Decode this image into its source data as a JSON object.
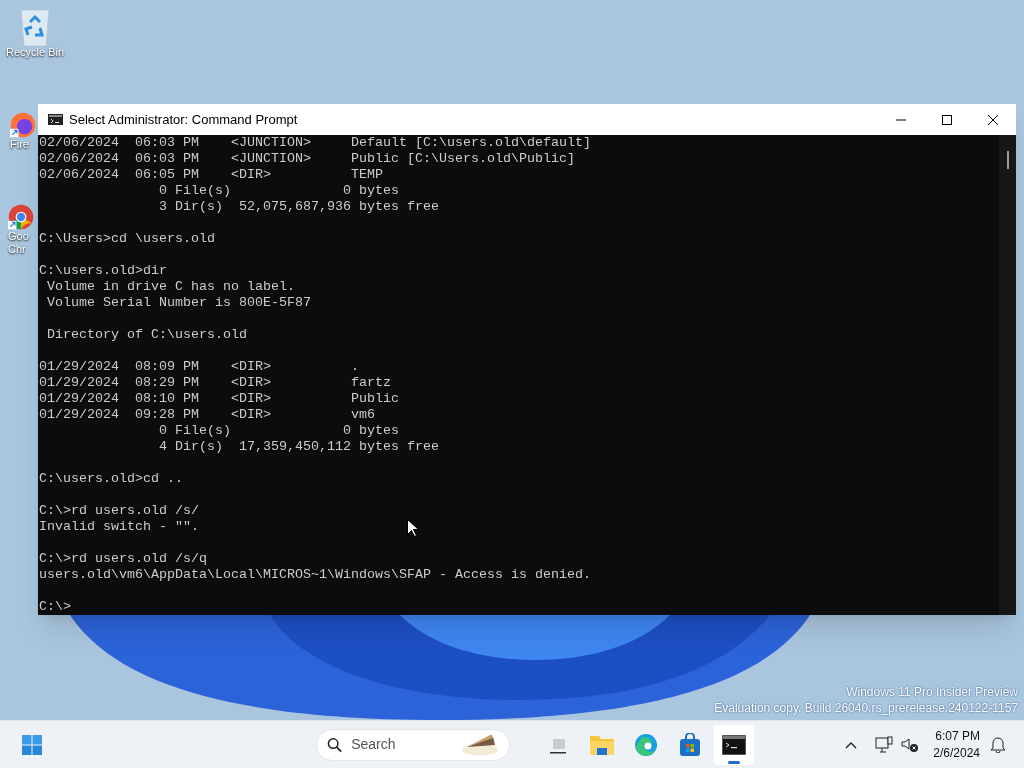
{
  "desktop_icons": [
    {
      "kind": "recycle",
      "label": [
        "Recycle Bin"
      ]
    },
    {
      "kind": "firefox",
      "label": [
        "Fire"
      ]
    },
    {
      "kind": "chrome",
      "label": [
        "Goo",
        "Chr"
      ]
    }
  ],
  "window": {
    "title": "Select Administrator: Command Prompt",
    "console_blocks": [
      [
        "02/06/2024  06:03 PM    <JUNCTION>     Default [C:\\users.old\\default]",
        "02/06/2024  06:03 PM    <JUNCTION>     Public [C:\\Users.old\\Public]",
        "02/06/2024  06:05 PM    <DIR>          TEMP",
        "               0 File(s)              0 bytes",
        "               3 Dir(s)  52,075,687,936 bytes free"
      ],
      [
        "C:\\Users>cd \\users.old"
      ],
      [
        "C:\\users.old>dir",
        " Volume in drive C has no label.",
        " Volume Serial Number is 800E-5F87"
      ],
      [
        " Directory of C:\\users.old"
      ],
      [
        "01/29/2024  08:09 PM    <DIR>          .",
        "01/29/2024  08:29 PM    <DIR>          fartz",
        "01/29/2024  08:10 PM    <DIR>          Public",
        "01/29/2024  09:28 PM    <DIR>          vm6",
        "               0 File(s)              0 bytes",
        "               4 Dir(s)  17,359,450,112 bytes free"
      ],
      [
        "C:\\users.old>cd .."
      ],
      [
        "C:\\>rd users.old /s/",
        "Invalid switch - \"\"."
      ],
      [
        "C:\\>rd users.old /s/q",
        "users.old\\vm6\\AppData\\Local\\MICROS~1\\Windows\\SFAP - Access is denied."
      ],
      [
        "C:\\>"
      ]
    ]
  },
  "watermark": [
    "Windows 11 Pro Insider Preview",
    "Evaluation copy. Build 26040.rs_prerelease.240122-1157"
  ],
  "taskbar": {
    "search": {
      "placeholder": "Search"
    },
    "apps": [
      {
        "kind": "taskview",
        "selected": false
      },
      {
        "kind": "explorer",
        "selected": false
      },
      {
        "kind": "edge",
        "selected": false
      },
      {
        "kind": "store",
        "selected": false
      },
      {
        "kind": "terminal",
        "selected": true
      }
    ],
    "time": "6:07 PM",
    "date": "2/6/2024"
  }
}
